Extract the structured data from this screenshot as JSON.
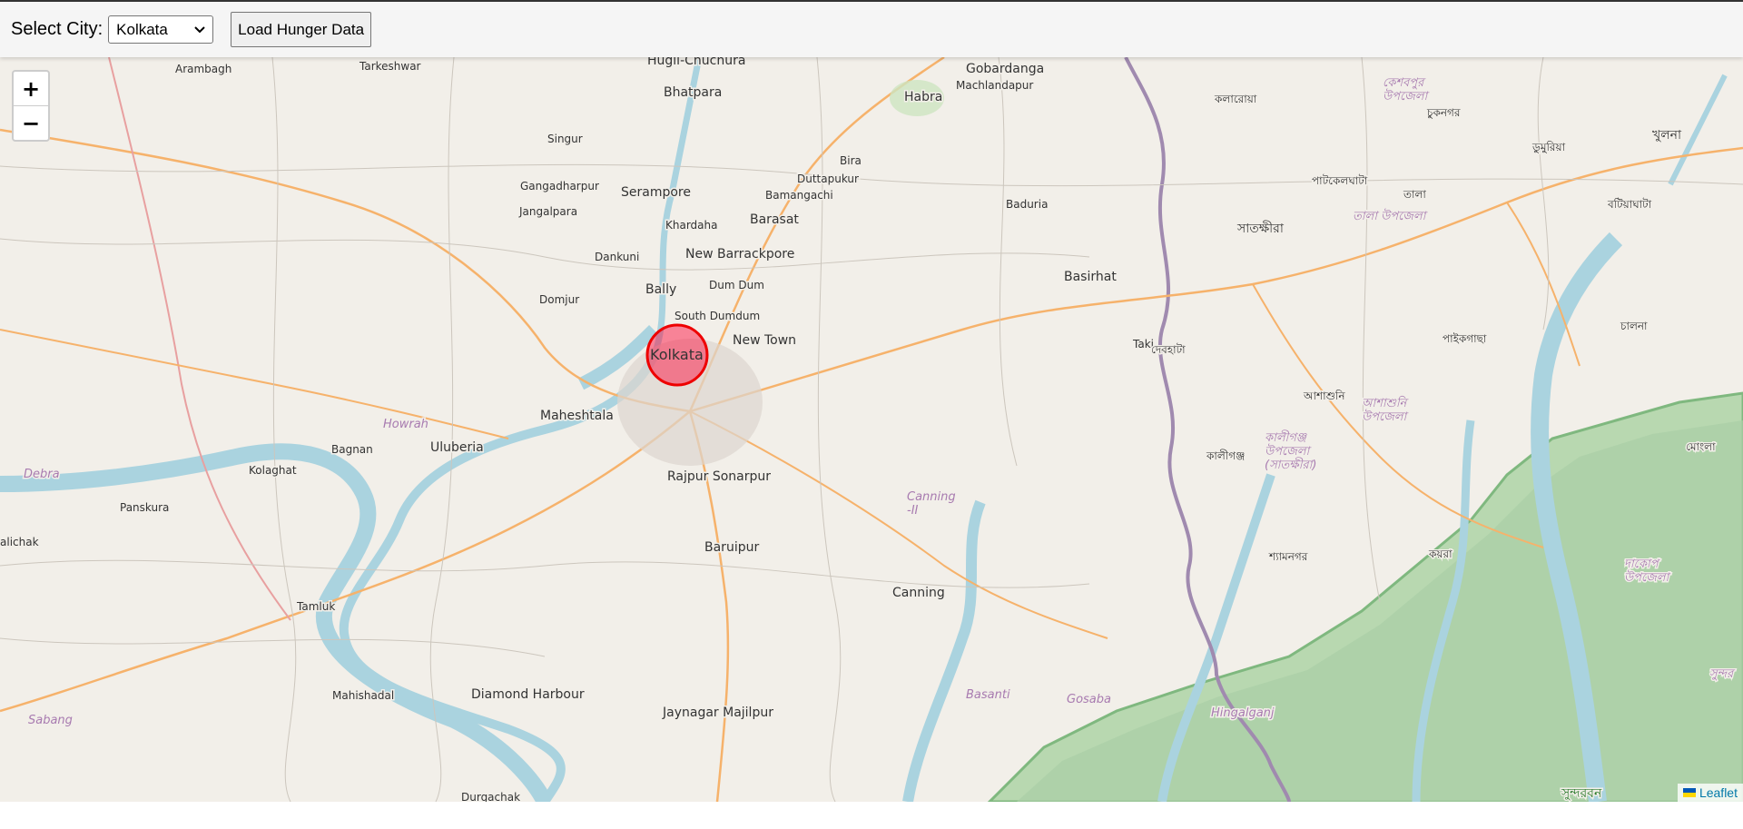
{
  "controls": {
    "city_label": "Select City:",
    "city_value": "Kolkata",
    "load_button": "Load Hunger Data"
  },
  "map": {
    "zoom_in": "+",
    "zoom_out": "−",
    "attribution": "Leaflet",
    "marker": {
      "city": "Kolkata",
      "fill_color": "#f03",
      "stroke_color": "#e00"
    },
    "places": {
      "hugli": "Hugli-Chuchura",
      "bhatpara": "Bhatpara",
      "habra": "Habra",
      "gobardanga": "Gobardanga",
      "machlandapur": "Machlandapur",
      "arambagh": "Arambagh",
      "tarkeshwar": "Tarkeshwar",
      "singur": "Singur",
      "bira": "Bira",
      "duttapukur": "Duttapukur",
      "gangadharpur": "Gangadharpur",
      "serampore": "Serampore",
      "bamangachi": "Bamangachi",
      "baduria": "Baduria",
      "jangalpara": "Jangalpara",
      "khardaha": "Khardaha",
      "barasat": "Barasat",
      "dankuni": "Dankuni",
      "new_barrackpore": "New Barrackpore",
      "basirhat": "Basirhat",
      "bally": "Bally",
      "dum_dum": "Dum Dum",
      "domjur": "Domjur",
      "south_dumdum": "South Dumdum",
      "new_town": "New Town",
      "taki": "Taki",
      "maheshtala": "Maheshtala",
      "howrah": "Howrah",
      "bagnan": "Bagnan",
      "uluberia": "Uluberia",
      "kolaghat": "Kolaghat",
      "debra": "Debra",
      "rajpur_sonarpur": "Rajpur Sonarpur",
      "canning_ii": "Canning\n-II",
      "panskura": "Panskura",
      "baruipur": "Baruipur",
      "alichak": "alichak",
      "tamluk": "Tamluk",
      "canning": "Canning",
      "mahishadal": "Mahishadal",
      "diamond_harbour": "Diamond Harbour",
      "basanti": "Basanti",
      "gosaba": "Gosaba",
      "hingalganj": "Hingalganj",
      "sabang": "Sabang",
      "jaynagar": "Jaynagar Majilpur",
      "durgachak": "Durgachak",
      "khulna": "খুলনা",
      "satkhira": "সাতক্ষীরা",
      "kolaroa": "কলারোয়া",
      "keshabpur": "কেশবপুর\nউপজেলা",
      "dumuria": "ডুমুরিয়া",
      "chuknagar": "চুকনগর",
      "patkelghata": "পাটকেলঘাটা",
      "tala": "তালা",
      "tala_upazila": "তালা উপজেলা",
      "batiaghata": "বটিয়াঘাটা",
      "debhata": "দেবহাটা",
      "paikgachha": "পাইকগাছা",
      "chalna": "চালনা",
      "ashashuni": "আশাশুনি",
      "ashashuni_upazila": "আশাশুনি\nউপজেলা",
      "kaliganj": "কালীগঞ্জ",
      "kaliganj_upazila": "কালীগঞ্জ\nউপজেলা\n(সাতক্ষীরা)",
      "mongla": "মোংলা",
      "shyamnagar": "শ্যামনগর",
      "koyra": "কয়রা",
      "dacope": "দাকোপ\nউপজেলা",
      "sundarban": "সুন্দরবন",
      "sundarban_edge": "সুন্দর"
    }
  },
  "colors": {
    "land": "#f2efe9",
    "water": "#aad3df",
    "mangrove": "#9fc9a0",
    "road_major": "#f6b26b",
    "border": "#a08aaf"
  }
}
